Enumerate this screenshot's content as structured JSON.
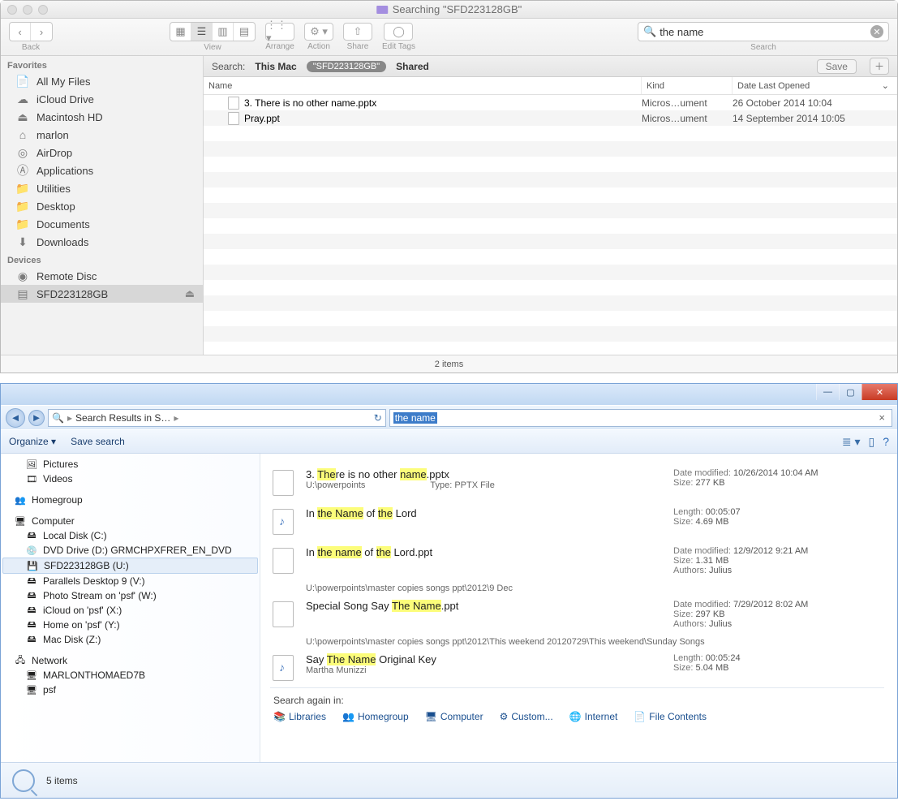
{
  "mac": {
    "title": "Searching \"SFD223128GB\"",
    "toolbar": {
      "back": "Back",
      "view": "View",
      "arrange": "Arrange",
      "action": "Action",
      "share": "Share",
      "edit_tags": "Edit Tags",
      "search": "Search"
    },
    "search_value": "the name",
    "sidebar": {
      "favorites_label": "Favorites",
      "devices_label": "Devices",
      "favorites": [
        {
          "label": "All My Files",
          "icon": "all-files"
        },
        {
          "label": "iCloud Drive",
          "icon": "cloud"
        },
        {
          "label": "Macintosh HD",
          "icon": "hdd"
        },
        {
          "label": "marlon",
          "icon": "home"
        },
        {
          "label": "AirDrop",
          "icon": "airdrop"
        },
        {
          "label": "Applications",
          "icon": "apps"
        },
        {
          "label": "Utilities",
          "icon": "folder"
        },
        {
          "label": "Desktop",
          "icon": "folder"
        },
        {
          "label": "Documents",
          "icon": "folder"
        },
        {
          "label": "Downloads",
          "icon": "download"
        }
      ],
      "devices": [
        {
          "label": "Remote Disc",
          "icon": "disc"
        },
        {
          "label": "SFD223128GB",
          "icon": "drive",
          "selected": true
        }
      ]
    },
    "scope": {
      "label": "Search:",
      "this_mac": "This Mac",
      "pill": "\"SFD223128GB\"",
      "shared": "Shared",
      "save": "Save"
    },
    "columns": {
      "name": "Name",
      "kind": "Kind",
      "date": "Date Last Opened"
    },
    "rows": [
      {
        "name": "3. There is no other name.pptx",
        "kind": "Micros…ument",
        "date": "26 October 2014 10:04"
      },
      {
        "name": "Pray.ppt",
        "kind": "Micros…ument",
        "date": "14 September 2014 10:05"
      }
    ],
    "status": "2 items"
  },
  "win": {
    "breadcrumb": "Search Results in S…",
    "search_value": "the name",
    "cmd": {
      "organize": "Organize",
      "save": "Save search"
    },
    "sidebar": {
      "items0": [
        {
          "label": "Pictures",
          "icon": "pic"
        },
        {
          "label": "Videos",
          "icon": "vid"
        }
      ],
      "homegroup": "Homegroup",
      "computer": "Computer",
      "drives": [
        {
          "label": "Local Disk (C:)",
          "icon": "hdd"
        },
        {
          "label": "DVD Drive (D:) GRMCHPXFRER_EN_DVD",
          "icon": "dvd"
        },
        {
          "label": "SFD223128GB (U:)",
          "icon": "usb",
          "selected": true
        },
        {
          "label": "Parallels Desktop 9 (V:)",
          "icon": "hdd"
        },
        {
          "label": "Photo Stream on 'psf' (W:)",
          "icon": "net"
        },
        {
          "label": "iCloud on 'psf' (X:)",
          "icon": "net"
        },
        {
          "label": "Home on 'psf' (Y:)",
          "icon": "net"
        },
        {
          "label": "Mac Disk (Z:)",
          "icon": "net"
        }
      ],
      "network": "Network",
      "net_items": [
        {
          "label": "MARLONTHOMAED7B"
        },
        {
          "label": "psf"
        }
      ]
    },
    "results": [
      {
        "title_parts": [
          {
            "t": "3. "
          },
          {
            "t": "The",
            "hl": 1
          },
          {
            "t": "re is no other "
          },
          {
            "t": "name",
            "hl": 1
          },
          {
            "t": ".pptx"
          }
        ],
        "sub": "U:\\powerpoints",
        "type_label": "Type:",
        "type": "PPTX File",
        "m1l": "Date modified:",
        "m1": "10/26/2014 10:04 AM",
        "m2l": "Size:",
        "m2": "277 KB",
        "icn": "doc"
      },
      {
        "title_parts": [
          {
            "t": "In "
          },
          {
            "t": "the Name",
            "hl": 1
          },
          {
            "t": " of "
          },
          {
            "t": "the",
            "hl": 1
          },
          {
            "t": " Lord"
          }
        ],
        "m1l": "Length:",
        "m1": "00:05:07",
        "m2l": "Size:",
        "m2": "4.69 MB",
        "icn": "mus"
      },
      {
        "title_parts": [
          {
            "t": "In "
          },
          {
            "t": "the name",
            "hl": 1
          },
          {
            "t": " of "
          },
          {
            "t": "the",
            "hl": 1
          },
          {
            "t": " Lord.ppt"
          }
        ],
        "m1l": "Date modified:",
        "m1": "12/9/2012 9:21 AM",
        "m2l": "Size:",
        "m2": "1.31 MB",
        "m3l": "Authors:",
        "m3": "Julius",
        "icn": "doc",
        "path": "U:\\powerpoints\\master copies songs ppt\\2012\\9 Dec"
      },
      {
        "title_parts": [
          {
            "t": "Special Song    Say "
          },
          {
            "t": "The Name",
            "hl": 1
          },
          {
            "t": ".ppt"
          }
        ],
        "m1l": "Date modified:",
        "m1": "7/29/2012 8:02 AM",
        "m2l": "Size:",
        "m2": "297 KB",
        "m3l": "Authors:",
        "m3": "Julius",
        "icn": "doc",
        "path": "U:\\powerpoints\\master copies songs ppt\\2012\\This weekend 20120729\\This weekend\\Sunday Songs"
      },
      {
        "title_parts": [
          {
            "t": "Say "
          },
          {
            "t": "The Name",
            "hl": 1
          },
          {
            "t": "    Original Key"
          }
        ],
        "sub": "Martha Munizzi",
        "m1l": "Length:",
        "m1": "00:05:24",
        "m2l": "Size:",
        "m2": "5.04 MB",
        "icn": "mus"
      }
    ],
    "search_again": {
      "label": "Search again in:",
      "links": [
        "Libraries",
        "Homegroup",
        "Computer",
        "Custom...",
        "Internet",
        "File Contents"
      ]
    },
    "status": "5 items"
  }
}
